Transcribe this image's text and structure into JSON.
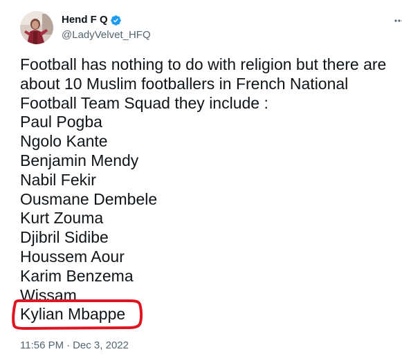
{
  "tweet": {
    "author": {
      "display_name": "Hend F Q",
      "handle": "@LadyVelvet_HFQ",
      "verified": true,
      "avatar_icon": "profile-photo-avatar"
    },
    "body_lines": [
      "Football has nothing to do with religion but there are",
      "about 10 Muslim footballers in French National",
      "Football Team Squad they include :",
      "Paul Pogba",
      "Ngolo Kante",
      "Benjamin Mendy",
      "Nabil Fekir",
      "Ousmane Dembele",
      "Kurt Zouma",
      "Djibril Sidibe",
      "Houssem Aour",
      "Karim Benzema",
      "Wissam",
      "Kylian Mbappe"
    ],
    "time": "11:56 PM",
    "separator": "·",
    "date": "Dec 3, 2022"
  },
  "colors": {
    "text": "#0f1419",
    "secondary": "#536471",
    "verified_blue": "#1d9bf0",
    "highlight_red": "#e0141e"
  },
  "icons": {
    "verified": "verified-badge-icon",
    "more": "more-options-icon"
  }
}
